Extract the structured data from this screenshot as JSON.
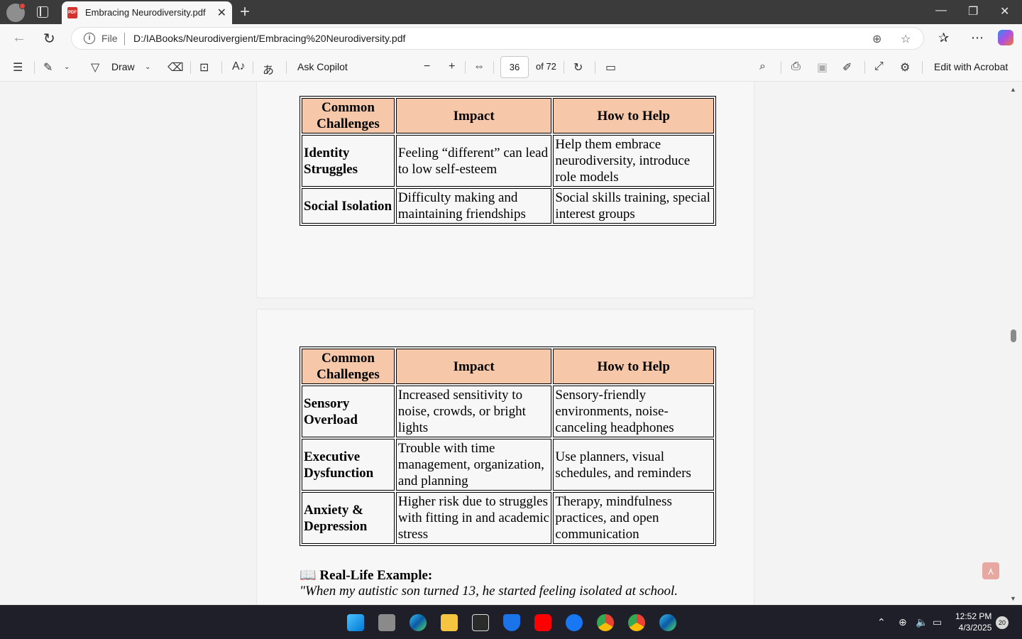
{
  "browser": {
    "tab_title": "Embracing Neurodiversity.pdf",
    "file_label": "File",
    "url": "D:/IABooks/Neurodivergient/Embracing%20Neurodiversity.pdf"
  },
  "pdf_toolbar": {
    "draw_label": "Draw",
    "ask_copilot_label": "Ask Copilot",
    "page_number": "36",
    "page_total": "of 72",
    "edit_acrobat_label": "Edit with Acrobat"
  },
  "table1": {
    "headers": [
      "Common Challenges",
      "Impact",
      "How to Help"
    ],
    "rows": [
      {
        "challenge": "Identity Struggles",
        "impact": "Feeling “different” can lead to low self-esteem",
        "help": "Help them embrace neurodiversity, introduce role models"
      },
      {
        "challenge": "Social Isolation",
        "impact": "Difficulty making and maintaining friendships",
        "help": "Social skills training, special interest groups"
      }
    ]
  },
  "table2": {
    "headers": [
      "Common Challenges",
      "Impact",
      "How to Help"
    ],
    "rows": [
      {
        "challenge": "Sensory Overload",
        "impact": "Increased sensitivity to noise, crowds, or bright lights",
        "help": "Sensory-friendly environments, noise-canceling headphones"
      },
      {
        "challenge": "Executive Dysfunction",
        "impact": "Trouble with time management, organization, and planning",
        "help": "Use planners, visual schedules, and reminders"
      },
      {
        "challenge": "Anxiety & Depression",
        "impact": "Higher risk due to struggles with fitting in and academic stress",
        "help": "Therapy, mindfulness practices, and open communication"
      }
    ]
  },
  "example": {
    "heading": "Real-Life Example:",
    "quote": "\"When my autistic son turned 13, he started feeling isolated at school."
  },
  "taskbar": {
    "time": "12:52 PM",
    "date": "4/3/2025",
    "notification_count": "20"
  }
}
